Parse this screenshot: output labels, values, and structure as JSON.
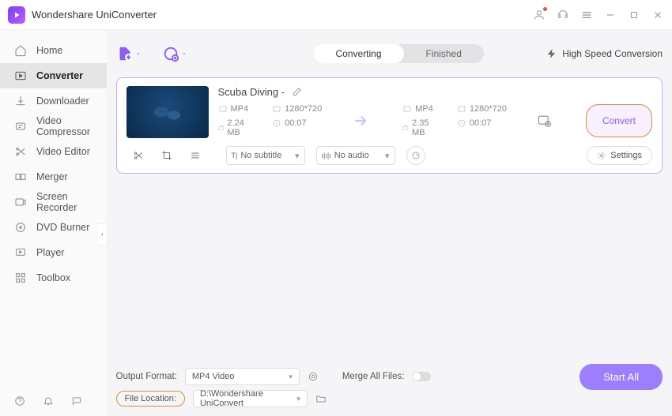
{
  "app": {
    "title": "Wondershare UniConverter"
  },
  "sidebar": {
    "items": [
      {
        "label": "Home"
      },
      {
        "label": "Converter"
      },
      {
        "label": "Downloader"
      },
      {
        "label": "Video Compressor"
      },
      {
        "label": "Video Editor"
      },
      {
        "label": "Merger"
      },
      {
        "label": "Screen Recorder"
      },
      {
        "label": "DVD Burner"
      },
      {
        "label": "Player"
      },
      {
        "label": "Toolbox"
      }
    ]
  },
  "tabs": {
    "converting": "Converting",
    "finished": "Finished"
  },
  "hsc": "High Speed Conversion",
  "file": {
    "name": "Scuba Diving -",
    "src": {
      "format": "MP4",
      "res": "1280*720",
      "size": "2.24 MB",
      "dur": "00:07"
    },
    "dst": {
      "format": "MP4",
      "res": "1280*720",
      "size": "2.35 MB",
      "dur": "00:07"
    },
    "subtitle": "No subtitle",
    "audio": "No audio",
    "settings": "Settings",
    "convert": "Convert"
  },
  "footer": {
    "output_format_label": "Output Format:",
    "output_format_value": "MP4 Video",
    "merge_label": "Merge All Files:",
    "file_location_label": "File Location:",
    "file_location_value": "D:\\Wondershare UniConvert",
    "start": "Start All"
  }
}
